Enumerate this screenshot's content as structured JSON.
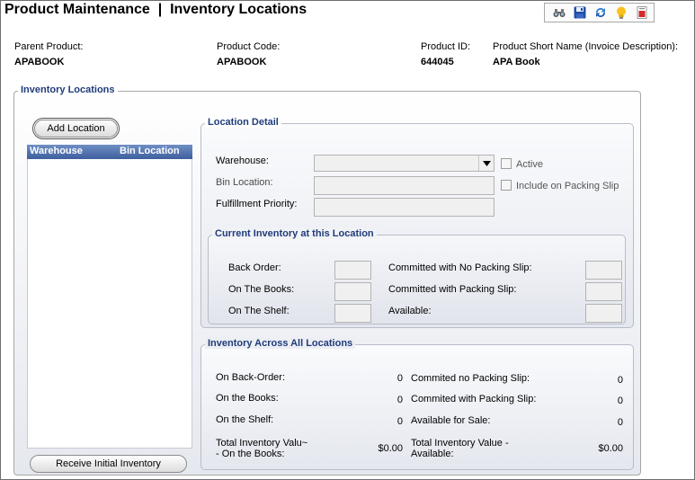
{
  "page": {
    "title": "Product Maintenance  |  Inventory Locations"
  },
  "toolbar": {
    "icons": [
      "binoculars-icon",
      "save-icon",
      "refresh-icon",
      "lightbulb-icon",
      "report-icon"
    ]
  },
  "header": {
    "parent_product_label": "Parent Product:",
    "parent_product_value": "APABOOK",
    "product_code_label": "Product Code:",
    "product_code_value": "APABOOK",
    "product_id_label": "Product ID:",
    "product_id_value": "644045",
    "short_name_label": "Product Short Name (Invoice Description):",
    "short_name_value": "APA Book"
  },
  "inventory_locations": {
    "title": "Inventory Locations",
    "add_location_label": "Add Location",
    "receive_initial_label": "Receive Initial Inventory",
    "grid_columns": [
      "Warehouse",
      "Bin Location"
    ],
    "grid_rows": []
  },
  "location_detail": {
    "title": "Location Detail",
    "warehouse_label": "Warehouse:",
    "warehouse_value": "",
    "bin_location_label": "Bin Location:",
    "bin_location_value": "",
    "fulfillment_priority_label": "Fulfillment Priority:",
    "fulfillment_priority_value": "",
    "active_label": "Active",
    "active_checked": false,
    "packing_slip_label": "Include on Packing Slip",
    "packing_slip_checked": false
  },
  "current_inventory": {
    "title": "Current Inventory at this Location",
    "back_order_label": "Back Order:",
    "on_books_label": "On The Books:",
    "on_shelf_label": "On The Shelf:",
    "committed_no_slip_label": "Committed with No Packing Slip:",
    "committed_slip_label": "Committed with Packing Slip:",
    "available_label": "Available:"
  },
  "across_all": {
    "title": "Inventory Across All Locations",
    "on_back_order_label": "On Back-Order:",
    "on_back_order_value": "0",
    "on_books_label": "On the Books:",
    "on_books_value": "0",
    "on_shelf_label": "On the Shelf:",
    "on_shelf_value": "0",
    "total_books_label_1": "Total Inventory Valu~",
    "total_books_label_2": "- On the Books:",
    "total_books_value": "$0.00",
    "committed_no_slip_label": "Commited no Packing Slip:",
    "committed_no_slip_value": "0",
    "committed_slip_label": "Commited with Packing Slip:",
    "committed_slip_value": "0",
    "available_sale_label": "Available for Sale:",
    "available_sale_value": "0",
    "total_available_label_1": "Total Inventory Value -",
    "total_available_label_2": "Available:",
    "total_available_value": "$0.00"
  }
}
